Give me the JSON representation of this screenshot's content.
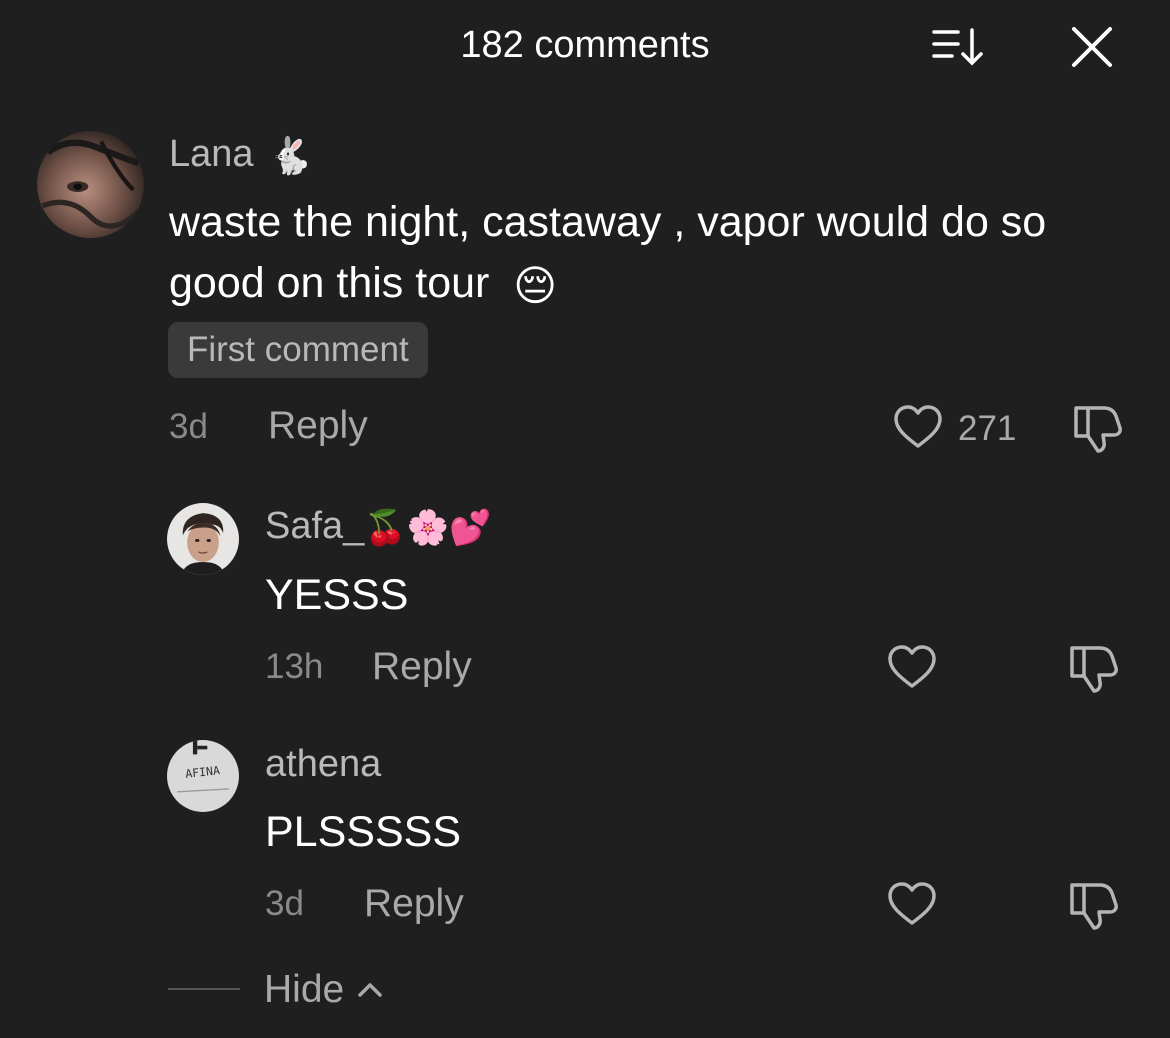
{
  "header": {
    "title": "182 comments",
    "sort_icon": "sort-icon",
    "close_icon": "close-icon"
  },
  "comments": [
    {
      "username": "Lana",
      "username_emoji": "🐇",
      "text": "waste the night, castaway , vapor would do so good on this tour",
      "text_emoji": "😔",
      "badge": "First comment",
      "time": "3d",
      "reply_label": "Reply",
      "like_count": "271"
    },
    {
      "username": "Safa_",
      "username_emoji": "🍒🌸💕",
      "text": "YESSS",
      "time": "13h",
      "reply_label": "Reply"
    },
    {
      "username": "athena",
      "avatar_text": "AFINA",
      "text": "PLSSSSS",
      "time": "3d",
      "reply_label": "Reply"
    }
  ],
  "hide_label": "Hide",
  "colors": {
    "background": "#1f1f1f",
    "text": "#ffffff",
    "muted": "#a9a9a9",
    "badge_bg": "#3a3a3a"
  }
}
